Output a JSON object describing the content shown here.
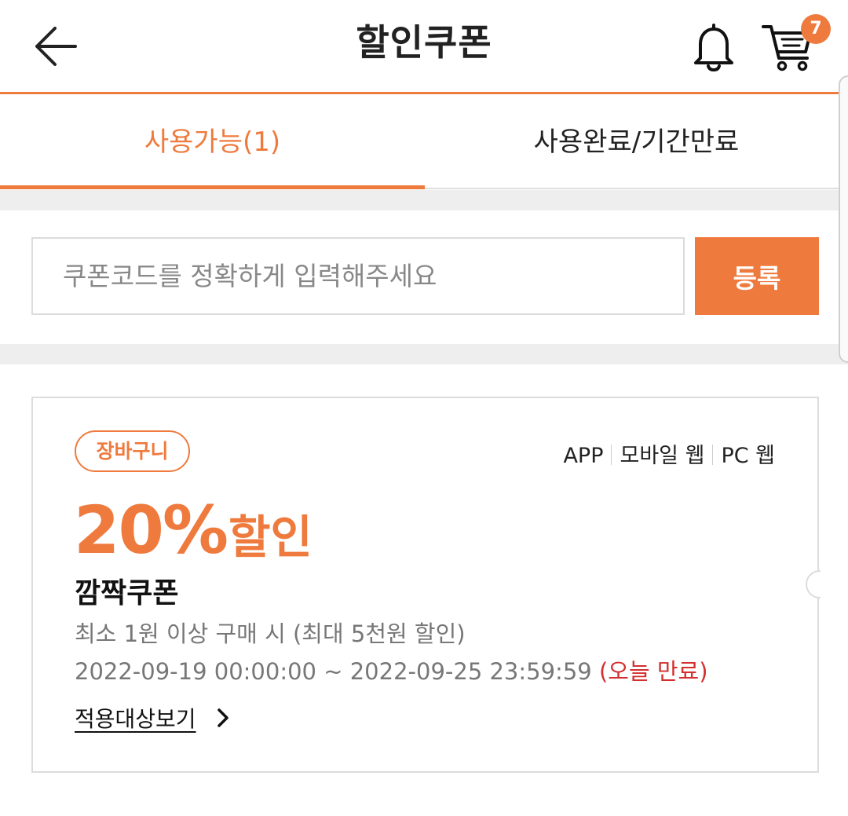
{
  "header": {
    "title": "할인쿠폰",
    "cart_count": "7"
  },
  "tabs": [
    {
      "label": "사용가능(1)",
      "active": true
    },
    {
      "label": "사용완료/기간만료",
      "active": false
    }
  ],
  "coupon_code": {
    "placeholder": "쿠폰코드를 정확하게 입력해주세요",
    "value": "",
    "register_label": "등록"
  },
  "coupon": {
    "tag": "장바구니",
    "platforms": [
      "APP",
      "모바일 웹",
      "PC 웹"
    ],
    "discount_value": "20%",
    "discount_suffix": "할인",
    "name": "깜짝쿠폰",
    "condition": "최소 1원 이상 구매 시 (최대 5천원 할인)",
    "period": "2022-09-19 00:00:00 ~ 2022-09-25 23:59:59",
    "expiry_note": "(오늘 만료)",
    "view_target_label": "적용대상보기"
  },
  "colors": {
    "accent": "#ef7a3d",
    "expiry_red": "#d32f2f",
    "border_gray": "#dcdcdc",
    "band_gray": "#eeeeee"
  },
  "icons": [
    "back-arrow-icon",
    "bell-icon",
    "cart-icon",
    "chevron-right-icon"
  ]
}
